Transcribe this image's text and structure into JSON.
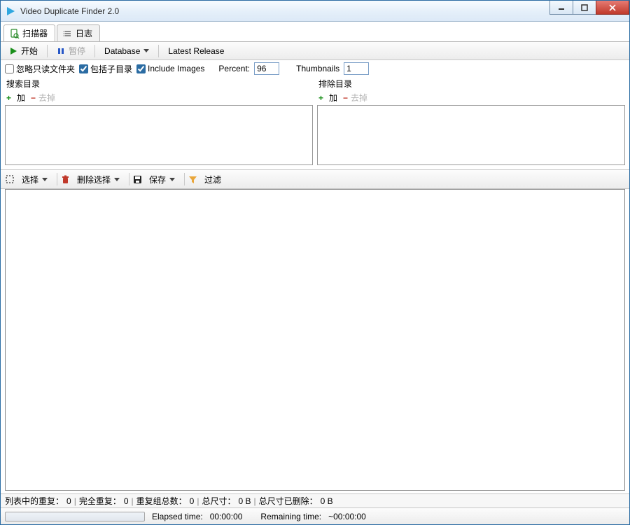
{
  "title": "Video Duplicate Finder 2.0",
  "tabs": {
    "scanner": "扫描器",
    "log": "日志"
  },
  "toolbar": {
    "start": "开始",
    "pause": "暂停",
    "database": "Database",
    "latest": "Latest Release"
  },
  "options": {
    "ignoreReadonly": {
      "label": "忽略只读文件夹",
      "checked": false
    },
    "includeSub": {
      "label": "包括子目录",
      "checked": true
    },
    "includeImages": {
      "label": "Include Images",
      "checked": true
    },
    "percentLabel": "Percent:",
    "percentValue": "96",
    "thumbsLabel": "Thumbnails",
    "thumbsValue": "1"
  },
  "dirs": {
    "search": {
      "label": "搜索目录",
      "add": "加",
      "remove": "去掉"
    },
    "exclude": {
      "label": "排除目录",
      "add": "加",
      "remove": "去掉"
    }
  },
  "mid": {
    "select": "选择",
    "deleteSel": "删除选择",
    "save": "保存",
    "filter": "过滤"
  },
  "stats": {
    "dupInList": {
      "label": "列表中的重复：",
      "value": "0"
    },
    "fullDup": {
      "label": "完全重复：",
      "value": "0"
    },
    "groupTotal": {
      "label": "重复组总数：",
      "value": "0"
    },
    "totalSize": {
      "label": "总尺寸：",
      "value": "0 B"
    },
    "deletedSize": {
      "label": "总尺寸已删除：",
      "value": "0 B"
    }
  },
  "bottom": {
    "elapsedLabel": "Elapsed time:",
    "elapsedValue": "00:00:00",
    "remainingLabel": "Remaining time:",
    "remainingValue": "~00:00:00"
  }
}
